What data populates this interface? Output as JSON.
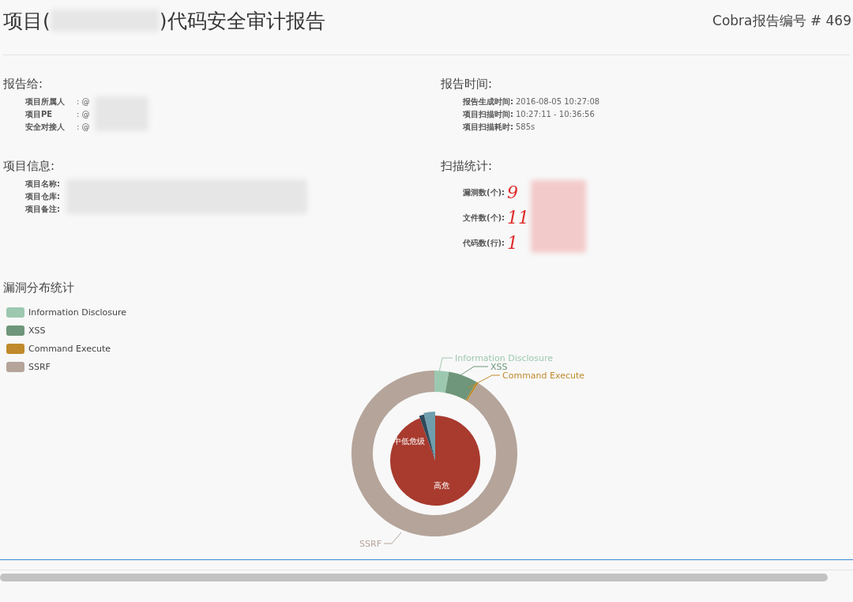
{
  "header": {
    "title_start": "项目(",
    "title_end": ")代码安全审计报告",
    "report_number": "Cobra报告编号 # 469"
  },
  "report_to": {
    "heading": "报告给:",
    "rows": [
      {
        "label": "项目所属人",
        "value": ": @"
      },
      {
        "label": "项目PE",
        "value": ": @"
      },
      {
        "label": "安全对接人",
        "value": ": @"
      }
    ]
  },
  "project_info": {
    "heading": "项目信息:",
    "rows": [
      {
        "label": "项目名称:"
      },
      {
        "label": "项目仓库:"
      },
      {
        "label": "项目备注:"
      }
    ]
  },
  "report_time": {
    "heading": "报告时间:",
    "rows": [
      {
        "label": "报告生成时间:",
        "value": "2016-08-05 10:27:08"
      },
      {
        "label": "项目扫描时间:",
        "value": "10:27:11 - 10:36:56"
      },
      {
        "label": "项目扫描耗时:",
        "value": "585s"
      }
    ]
  },
  "scan_stats": {
    "heading": "扫描统计:",
    "rows": [
      {
        "label": "漏洞数(个):",
        "value": "9"
      },
      {
        "label": "文件数(个):",
        "value": "11"
      },
      {
        "label": "代码数(行):",
        "value": "1"
      }
    ]
  },
  "chart": {
    "heading": "漏洞分布统计",
    "legend": [
      {
        "name": "Information Disclosure",
        "color": "#9dc8b0"
      },
      {
        "name": "XSS",
        "color": "#6f967a"
      },
      {
        "name": "Command Execute",
        "color": "#c08a2c"
      },
      {
        "name": "SSRF",
        "color": "#b5a49a"
      }
    ],
    "outer_slices": [
      {
        "label": "Information Disclosure",
        "color": "#9dc8b0"
      },
      {
        "label": "XSS",
        "color": "#6f967a"
      },
      {
        "label": "Command Execute",
        "color": "#c08a2c"
      },
      {
        "label": "SSRF",
        "color": "#b5a49a"
      }
    ],
    "inner_slices": [
      {
        "label": "中低危级",
        "color": "#6f9fae"
      },
      {
        "color": "#2e4a5a"
      },
      {
        "label": "高危",
        "color": "#a83a2e"
      }
    ]
  }
}
